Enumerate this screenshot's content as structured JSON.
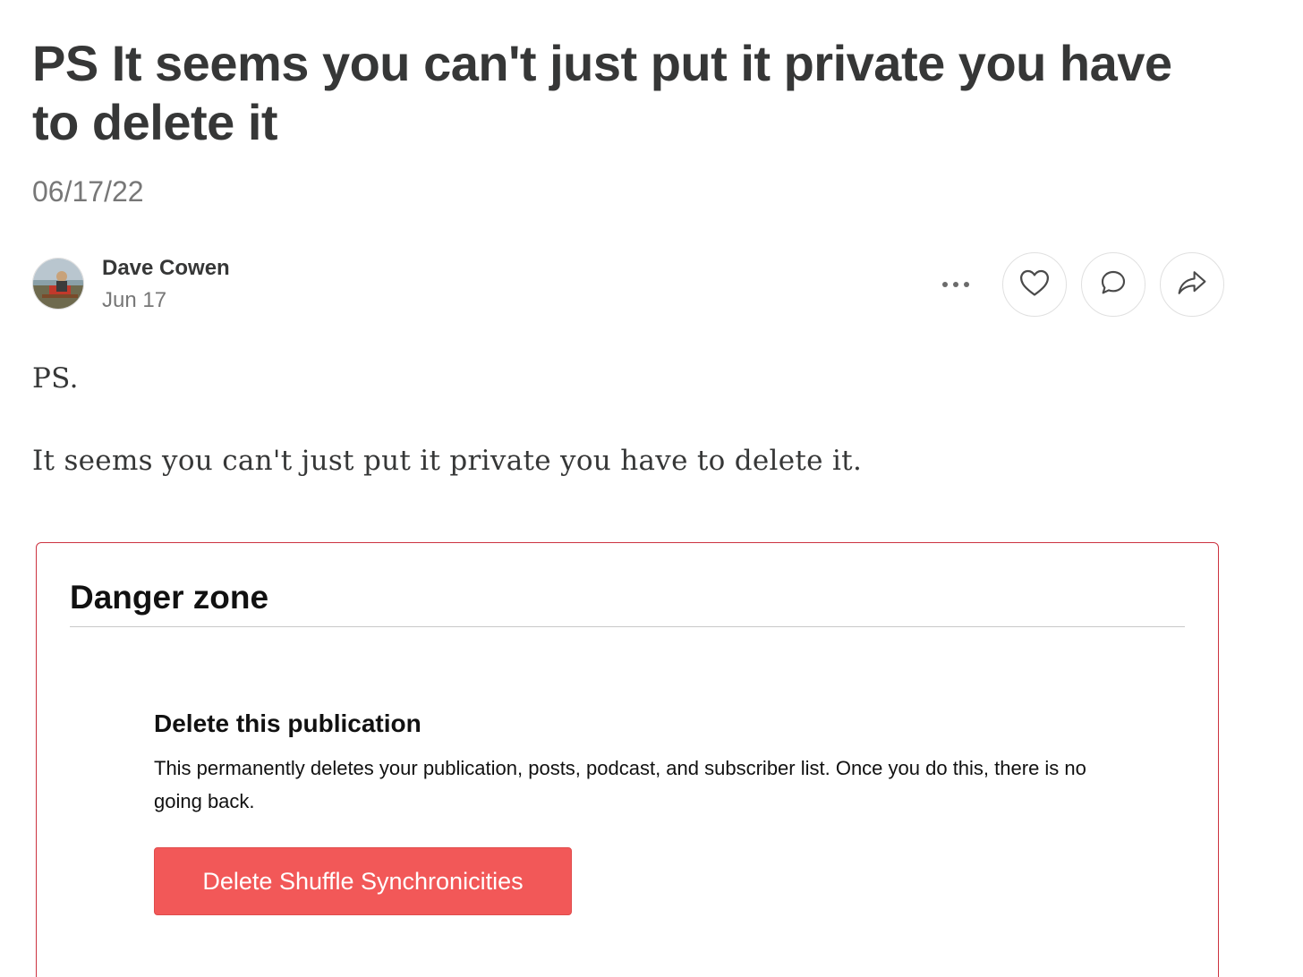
{
  "post": {
    "title": "PS It seems you can't just put it private you have to delete it",
    "date": "06/17/22"
  },
  "byline": {
    "author": "Dave Cowen",
    "date": "Jun 17"
  },
  "actions": {
    "more_icon": "ellipsis-icon",
    "like_icon": "heart-icon",
    "comment_icon": "comment-bubble-icon",
    "share_icon": "share-arrow-icon"
  },
  "body": {
    "paragraphs": [
      "PS.",
      "It seems you can't just put it private you have to delete it."
    ]
  },
  "danger_zone": {
    "heading": "Danger zone",
    "delete_title": "Delete this publication",
    "delete_description": "This permanently deletes your publication, posts, podcast, and subscriber list. Once you do this, there is no going back.",
    "delete_button": "Delete Shuffle Synchronicities",
    "border_color": "#cc3340",
    "button_color": "#f25858"
  }
}
